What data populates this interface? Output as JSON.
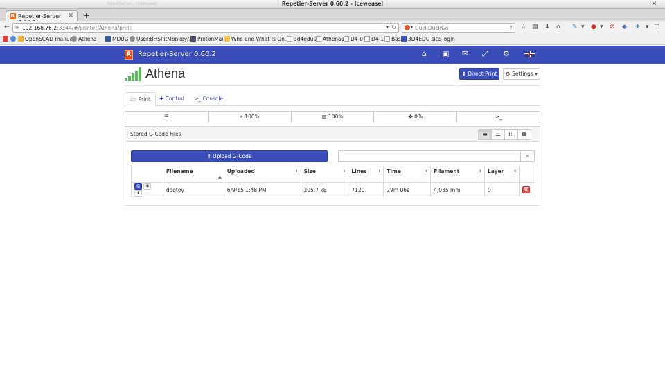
{
  "window": {
    "title": "Repetier-Server 0.60.2 - Iceweasel",
    "ghost_text": "Repetier-Se… Iceweasel",
    "close": "✕"
  },
  "tab": {
    "label": "Repetier-Server 0.60.2",
    "close": "✕",
    "new": "+"
  },
  "nav": {
    "url_host": "192.168.76.2",
    "url_rest": ":3344/#/printer/Athena/print",
    "search_placeholder": "DuckDuckGo"
  },
  "bookmarks": [
    {
      "label": "",
      "color": "#d9453d"
    },
    {
      "label": "",
      "color": "#4a8ad6"
    },
    {
      "label": "OpenSCAD manual",
      "color": "#f0b13a"
    },
    {
      "label": "Athena",
      "color": "#8c8c8c"
    },
    {
      "label": "MDUG",
      "color": "#3b5998"
    },
    {
      "label": "User:BHSPitMonkey/…",
      "color": "#8c8c8c"
    },
    {
      "label": "ProtonMail",
      "color": "#505062"
    },
    {
      "label": "Who and What Is On…",
      "color": "#f2c14e"
    },
    {
      "label": "3d4edu0",
      "color": "#cccccc"
    },
    {
      "label": "Athena1",
      "color": "#cccccc"
    },
    {
      "label": "D4-0",
      "color": "#cccccc"
    },
    {
      "label": "D4-1",
      "color": "#cccccc"
    },
    {
      "label": "Bas",
      "color": "#cccccc"
    },
    {
      "label": "3D4EDU site login",
      "color": "#3f51b5"
    }
  ],
  "app": {
    "name": "Repetier-Server 0.60.2",
    "logo_letter": "R",
    "header_icons": [
      "home-icon",
      "monitor-icon",
      "envelope-icon",
      "expand-icon",
      "gear-icon",
      "uk-flag-icon"
    ],
    "accent": "#3b4db8"
  },
  "printer": {
    "name": "Athena",
    "direct_print": "Direct Print",
    "settings": "Settings"
  },
  "tabs": [
    {
      "label": "Print",
      "icon": "🗁"
    },
    {
      "label": "Control",
      "icon": "✚"
    },
    {
      "label": "Console",
      "icon": ">_"
    }
  ],
  "status": {
    "list_icon": "☰",
    "speed": "100%",
    "flow": "100%",
    "fan": "0%",
    "console": ">_"
  },
  "files_panel": {
    "title": "Stored G-Code Files",
    "upload": "Upload G-Code",
    "filter_value": "",
    "columns": [
      "",
      "Filename",
      "Uploaded",
      "Size",
      "Lines",
      "Time",
      "Filament",
      "Layer",
      ""
    ],
    "rows": [
      {
        "filename": "dogtoy",
        "uploaded": "6/9/15 1:48 PM",
        "size": "205.7 kB",
        "lines": "7120",
        "time": "29m 06s",
        "filament": "4,035 mm",
        "layer": "0"
      }
    ]
  }
}
